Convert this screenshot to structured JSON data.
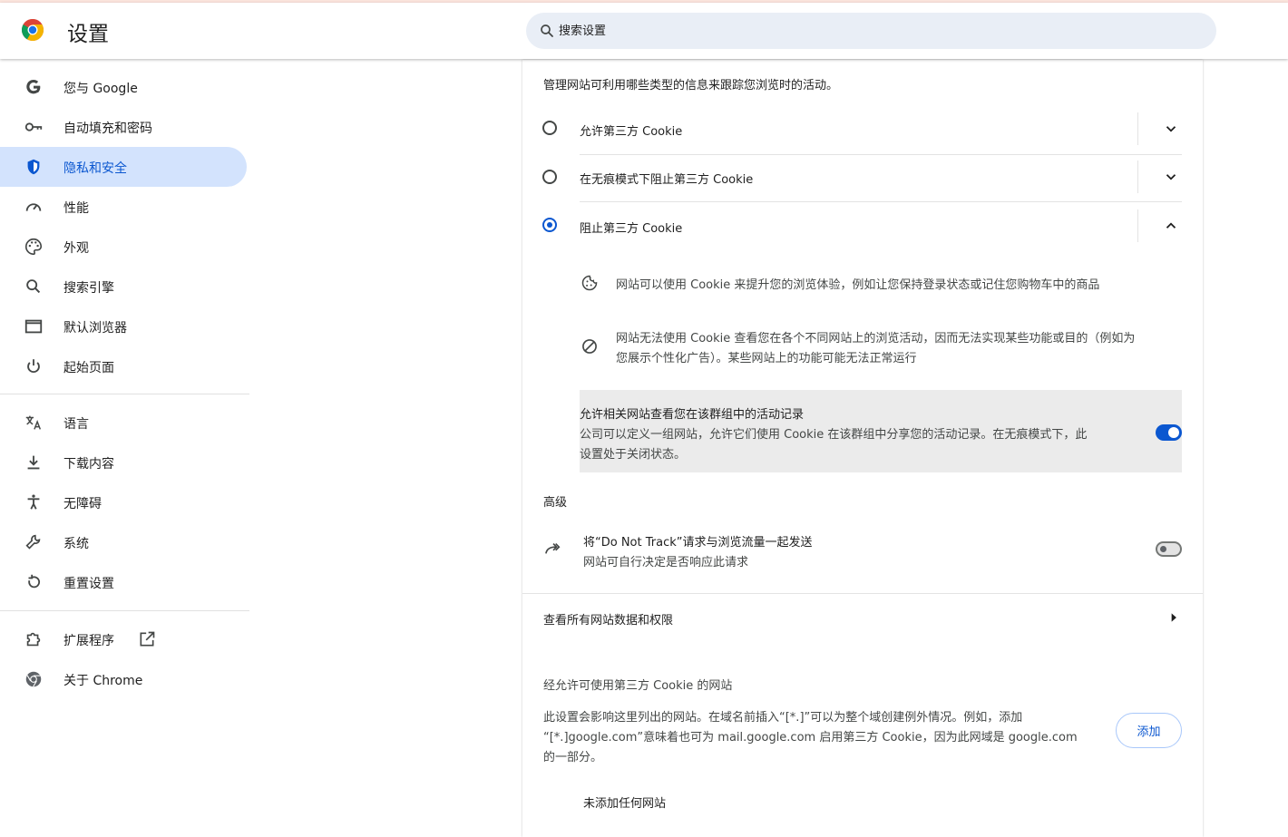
{
  "header": {
    "title": "设置",
    "search_placeholder": "搜索设置"
  },
  "sidebar": {
    "items": [
      {
        "label": "您与 Google",
        "icon": "google-g-icon"
      },
      {
        "label": "自动填充和密码",
        "icon": "key-icon"
      },
      {
        "label": "隐私和安全",
        "icon": "shield-icon",
        "active": true
      },
      {
        "label": "性能",
        "icon": "speedometer-icon"
      },
      {
        "label": "外观",
        "icon": "palette-icon"
      },
      {
        "label": "搜索引擎",
        "icon": "search-icon"
      },
      {
        "label": "默认浏览器",
        "icon": "browser-window-icon"
      },
      {
        "label": "起始页面",
        "icon": "power-icon"
      },
      {
        "label": "语言",
        "icon": "translate-icon"
      },
      {
        "label": "下载内容",
        "icon": "download-icon"
      },
      {
        "label": "无障碍",
        "icon": "accessibility-icon"
      },
      {
        "label": "系统",
        "icon": "wrench-icon"
      },
      {
        "label": "重置设置",
        "icon": "reset-icon"
      },
      {
        "label": "扩展程序",
        "icon": "puzzle-icon"
      },
      {
        "label": "关于 Chrome",
        "icon": "chrome-icon"
      }
    ]
  },
  "content": {
    "intro": "管理网站可利用哪些类型的信息来跟踪您浏览时的活动。",
    "options": [
      {
        "label": "允许第三方 Cookie",
        "selected": false
      },
      {
        "label": "在无痕模式下阻止第三方 Cookie",
        "selected": false
      },
      {
        "label": "阻止第三方 Cookie",
        "selected": true
      }
    ],
    "details": [
      {
        "text": "网站可以使用 Cookie 来提升您的浏览体验，例如让您保持登录状态或记住您购物车中的商品",
        "icon": "cookie-icon"
      },
      {
        "text_line1": "网站无法使用 Cookie 查看您在各个不同网站上的浏览活动，因而无法实现某些功能或目的（例如为",
        "text_line2": "您展示个性化广告）。某些网站上的功能可能无法正常运行",
        "icon": "block-icon"
      }
    ],
    "related_sites": {
      "title": "允许相关网站查看您在该群组中的活动记录",
      "desc_line1": "公司可以定义一组网站，允许它们使用 Cookie 在该群组中分享您的活动记录。在无痕模式下，此",
      "desc_line2": "设置处于关闭状态。",
      "enabled": true
    },
    "advanced": {
      "heading": "高级",
      "dnt_title": "将“Do Not Track”请求与浏览流量一起发送",
      "dnt_desc": "网站可自行决定是否响应此请求",
      "dnt_enabled": false
    },
    "all_sites_link": "查看所有网站数据和权限",
    "allowed_section": {
      "title": "经允许可使用第三方 Cookie 的网站",
      "desc_line1": "此设置会影响这里列出的网站。在域名前插入“[*.]”可以为整个域创建例外情况。例如，添加",
      "desc_line2": "“[*.]google.com”意味着也可为 mail.google.com 启用第三方 Cookie，因为此网域是 google.com",
      "desc_line3": "的一部分。",
      "add_label": "添加",
      "empty_text": "未添加任何网站"
    }
  }
}
